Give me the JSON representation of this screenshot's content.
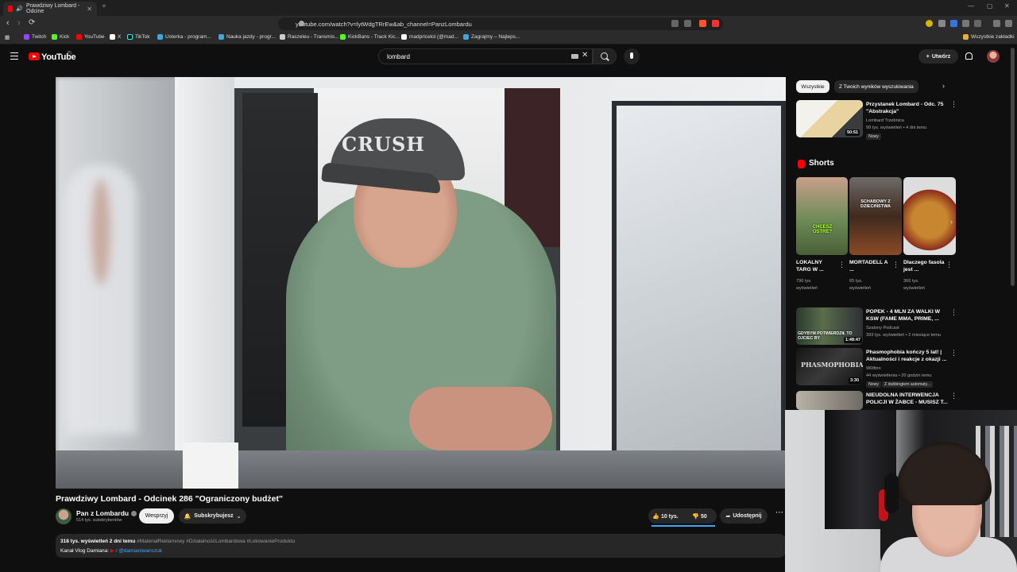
{
  "browser": {
    "tab_title": "Prawdziwy Lombard - Odcine",
    "url": "youtube.com/watch?v=lytWdgTRrEw&ab_channel=PanzLombardu",
    "bookmarks": [
      "Twitch",
      "Kick",
      "YouTube",
      "X",
      "TikTok",
      "Usterka - program...",
      "Nauka jazdy - progr...",
      "Raszeleu - Transmis...",
      "KickBans - Track Kic...",
      "madpricelol (@mad...",
      "Zagrajmy – Najleps..."
    ],
    "bookmarks_all": "Wszystkie zakładki"
  },
  "header": {
    "logo_text": "YouTube",
    "logo_sup": "PL",
    "search_value": "lombard",
    "create_label": "Utwórz"
  },
  "video": {
    "title": "Prawdziwy Lombard - Odcinek 286 \"Ograniczony budżet\"",
    "cap_text": "CRUSH",
    "channel": "Pan z Lombardu",
    "subscribers": "514 tys. subskrybentów",
    "support_label": "Wesprzyj",
    "subscribe_label": "Subskrybujesz",
    "likes": "10 tys.",
    "dislikes": "50",
    "share_label": "Udostępnij",
    "views_line": "318 tys. wyświetleń  2 dni temu",
    "tags": "#MateriałReklamowy #DziałalnośćLombardowa #LokowanieProduktu",
    "kanal_line": "Kanał Vlog Damiana:",
    "kanal_handle": "/ @damianiwanczuk"
  },
  "sidebar": {
    "chips": [
      "Wszystkie",
      "Z Twoich wyników wyszukiwania"
    ],
    "top_item": {
      "title": "Przystanek Lombard - Odc. 75 \"Abstrakcja\"",
      "channel": "Lombard Trzebnica",
      "meta": "99 tys. wyświetleń • 4 dni temu",
      "badge": "Nowy",
      "duration": "50:51"
    },
    "shorts_label": "Shorts",
    "shorts": [
      {
        "title": "LOKALNY TARG W ...",
        "views": "796 tys.",
        "unit": "wyświetleń",
        "overlay": "CHCESZ OSTRE?"
      },
      {
        "title": "MORTADELL A ...",
        "views": "65 tys.",
        "unit": "wyświetleń",
        "overlay": "SCHABOWY Z DZIECIŃSTWA"
      },
      {
        "title": "Dlaczego fasola jest ...",
        "views": "366 tys.",
        "unit": "wyświetleń",
        "overlay": ""
      }
    ],
    "items": [
      {
        "title": "POPEK - 4 MLN ZA WALKI W KSW (FAME MMA, PRIME, ...",
        "channel": "Szalony Podcast",
        "meta": "393 tys. wyświetleń • 2 miesiące temu",
        "duration": "1:48:47",
        "overlay": "GDYBYM POTWIERDZIŁ TO OJCIEC BY"
      },
      {
        "title": "Phasmophobia kończy 5 lat! | Aktualności i reakcje z okazji ...",
        "channel": "W0lfinn",
        "meta": "44 wyświetlenia • 20 godzin temu",
        "badge": "Nowy",
        "badge2": "Z dubbingiem automaty...",
        "duration": "3:30",
        "overlay": "PHASMOPHOBIA"
      },
      {
        "title": "NIEUDOLNA INTERWENCJA POLICJI W ŻABCE - MUSISZ T...",
        "channel": "",
        "meta": "",
        "duration": "",
        "overlay": ""
      }
    ]
  },
  "colors": {
    "background": "#0f0f0f",
    "brand_red": "#ff0000",
    "chip_active": "#f1f1f1",
    "surface": "#272727",
    "accent_blue": "#3ea6ff"
  }
}
